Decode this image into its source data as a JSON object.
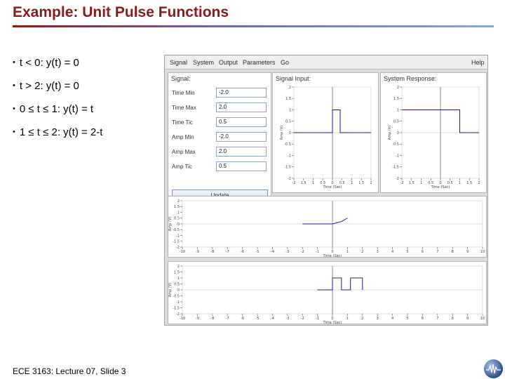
{
  "slide": {
    "title": "Example: Unit Pulse Functions",
    "footer": "ECE 3163: Lecture 07, Slide 3"
  },
  "bullets": [
    {
      "text": "t < 0: y(t) = 0"
    },
    {
      "text": "t > 2: y(t) = 0"
    },
    {
      "text": "0 ≤ t ≤ 1: y(t) = t"
    },
    {
      "text": "1 ≤ t ≤ 2: y(t) = 2-t"
    }
  ],
  "applet": {
    "menu": [
      "Signal",
      "System",
      "Output",
      "Parameters",
      "Go"
    ],
    "help": "Help",
    "signal_panel": {
      "title": "Signal:",
      "fields": [
        {
          "label": "Time Min",
          "value": "-2.0"
        },
        {
          "label": "Time Max",
          "value": "2.0"
        },
        {
          "label": "Time Tic",
          "value": "0.5"
        },
        {
          "label": "Amp Min",
          "value": "-2.0"
        },
        {
          "label": "Amp Max",
          "value": "2.0"
        },
        {
          "label": "Amp Tic",
          "value": "0.5"
        }
      ],
      "update_label": "Update"
    },
    "signal_input": {
      "title": "Signal Input:"
    },
    "system_response": {
      "title": "System Response:"
    }
  },
  "chart_data": [
    {
      "type": "line",
      "title": "Signal Input:",
      "xlabel": "Time (Sec)",
      "ylabel": "Amp (V)",
      "xlim": [
        -2,
        2
      ],
      "ylim": [
        -2,
        2
      ],
      "x_ticks": [
        "-2",
        "1.5",
        "1",
        "0.5",
        "0",
        "0.5",
        "1",
        "1.5",
        "2"
      ],
      "y_ticks": [
        "2",
        "1.5",
        "1",
        "0.5",
        "0",
        "-0.5",
        "-1",
        "-1.5",
        "-2"
      ],
      "series": [
        {
          "x": [
            -2,
            0,
            0,
            0.4,
            0.4,
            2
          ],
          "y": [
            0,
            0,
            1,
            1,
            0,
            0
          ]
        }
      ]
    },
    {
      "type": "line",
      "title": "System Response:",
      "xlabel": "Time (Sec)",
      "ylabel": "Amp (V)",
      "xlim": [
        -2,
        2
      ],
      "ylim": [
        -2,
        2
      ],
      "x_ticks": [
        "-2",
        "1.5",
        "1",
        "0.5",
        "0",
        "0.5",
        "1",
        "1.5",
        "2"
      ],
      "y_ticks": [
        "2",
        "1.5",
        "1",
        "0.5",
        "0",
        "-0.5",
        "-1",
        "-1.5",
        "-2"
      ],
      "series": [
        {
          "x": [
            -2,
            1,
            1,
            2
          ],
          "y": [
            1,
            1,
            0,
            0
          ]
        }
      ]
    },
    {
      "type": "line",
      "xlabel": "Time (Sec)",
      "ylabel": "Amp (V)",
      "xlim": [
        -10,
        10
      ],
      "ylim": [
        -2,
        2
      ],
      "x_ticks": [
        "-10",
        "-9",
        "-8",
        "-7",
        "-6",
        "-5",
        "-4",
        "-3",
        "-2",
        "-1",
        "0",
        "1",
        "2",
        "3",
        "4",
        "5",
        "6",
        "7",
        "8",
        "9",
        "10"
      ],
      "y_ticks": [
        "2",
        "1.5",
        "1",
        "0.5",
        "0",
        "-0.5",
        "-1",
        "-1.5",
        "-2"
      ],
      "series": [
        {
          "x": [
            -2,
            0,
            0.6,
            1
          ],
          "y": [
            0,
            0,
            0.2,
            0.5
          ]
        }
      ]
    },
    {
      "type": "line",
      "xlabel": "Time (Sec)",
      "ylabel": "Amp (V)",
      "xlim": [
        -10,
        10
      ],
      "ylim": [
        -2,
        2
      ],
      "x_ticks": [
        "-10",
        "-9",
        "-8",
        "-7",
        "-6",
        "-5",
        "-4",
        "-3",
        "-2",
        "-1",
        "0",
        "1",
        "2",
        "3",
        "4",
        "5",
        "6",
        "7",
        "8",
        "9",
        "10"
      ],
      "y_ticks": [
        "2",
        "1.5",
        "1",
        "0.5",
        "0",
        "-0.5",
        "-1",
        "-1.5",
        "-2"
      ],
      "series": [
        {
          "x": [
            -1,
            0,
            0,
            0.6,
            0.6,
            1.2,
            1.2,
            2,
            2
          ],
          "y": [
            0,
            0,
            1,
            1,
            0,
            0,
            1,
            1,
            0
          ]
        }
      ]
    }
  ],
  "colors": {
    "title": "#8b1a1a",
    "trace": "#1a1a8c",
    "axes": "#555555"
  }
}
